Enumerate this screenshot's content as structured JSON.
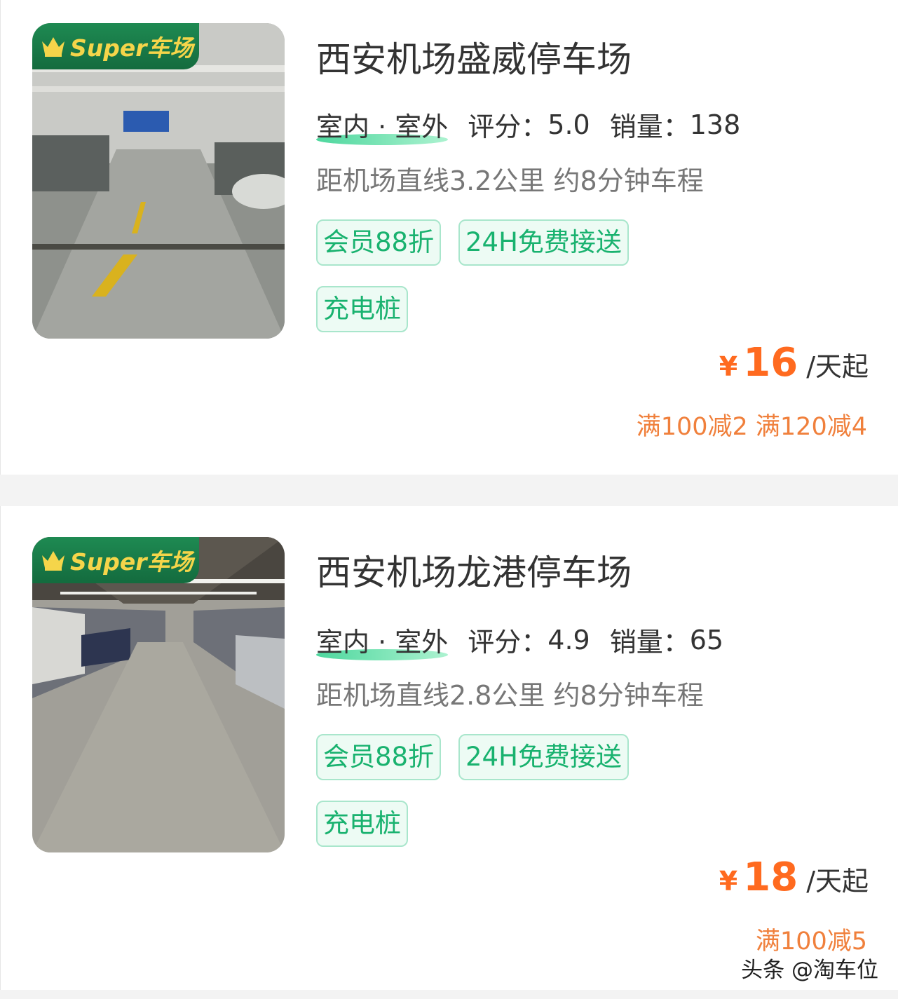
{
  "listings": [
    {
      "badge": "Super车场",
      "title": "西安机场盛威停车场",
      "type": "室内 · 室外",
      "rating_label": "评分：",
      "rating": "5.0",
      "sales_label": "销量：",
      "sales": "138",
      "distance": "距机场直线3.2公里 约8分钟车程",
      "tags": [
        "会员88折",
        "24H免费接送",
        "充电桩"
      ],
      "currency": "¥",
      "price": "16",
      "price_unit": "/天起",
      "promo": "满100减2 满120减4"
    },
    {
      "badge": "Super车场",
      "title": "西安机场龙港停车场",
      "type": "室内 · 室外",
      "rating_label": "评分：",
      "rating": "4.9",
      "sales_label": "销量：",
      "sales": "65",
      "distance": "距机场直线2.8公里 约8分钟车程",
      "tags": [
        "会员88折",
        "24H免费接送",
        "充电桩"
      ],
      "currency": "¥",
      "price": "18",
      "price_unit": "/天起",
      "promo": "满100减5"
    }
  ],
  "watermark": "头条 @淘车位",
  "colors": {
    "accent_green": "#19b26f",
    "badge_green": "#1e8a52",
    "badge_gold": "#f5d54a",
    "price_orange": "#ff6a1f",
    "promo_orange": "#f0803c"
  }
}
